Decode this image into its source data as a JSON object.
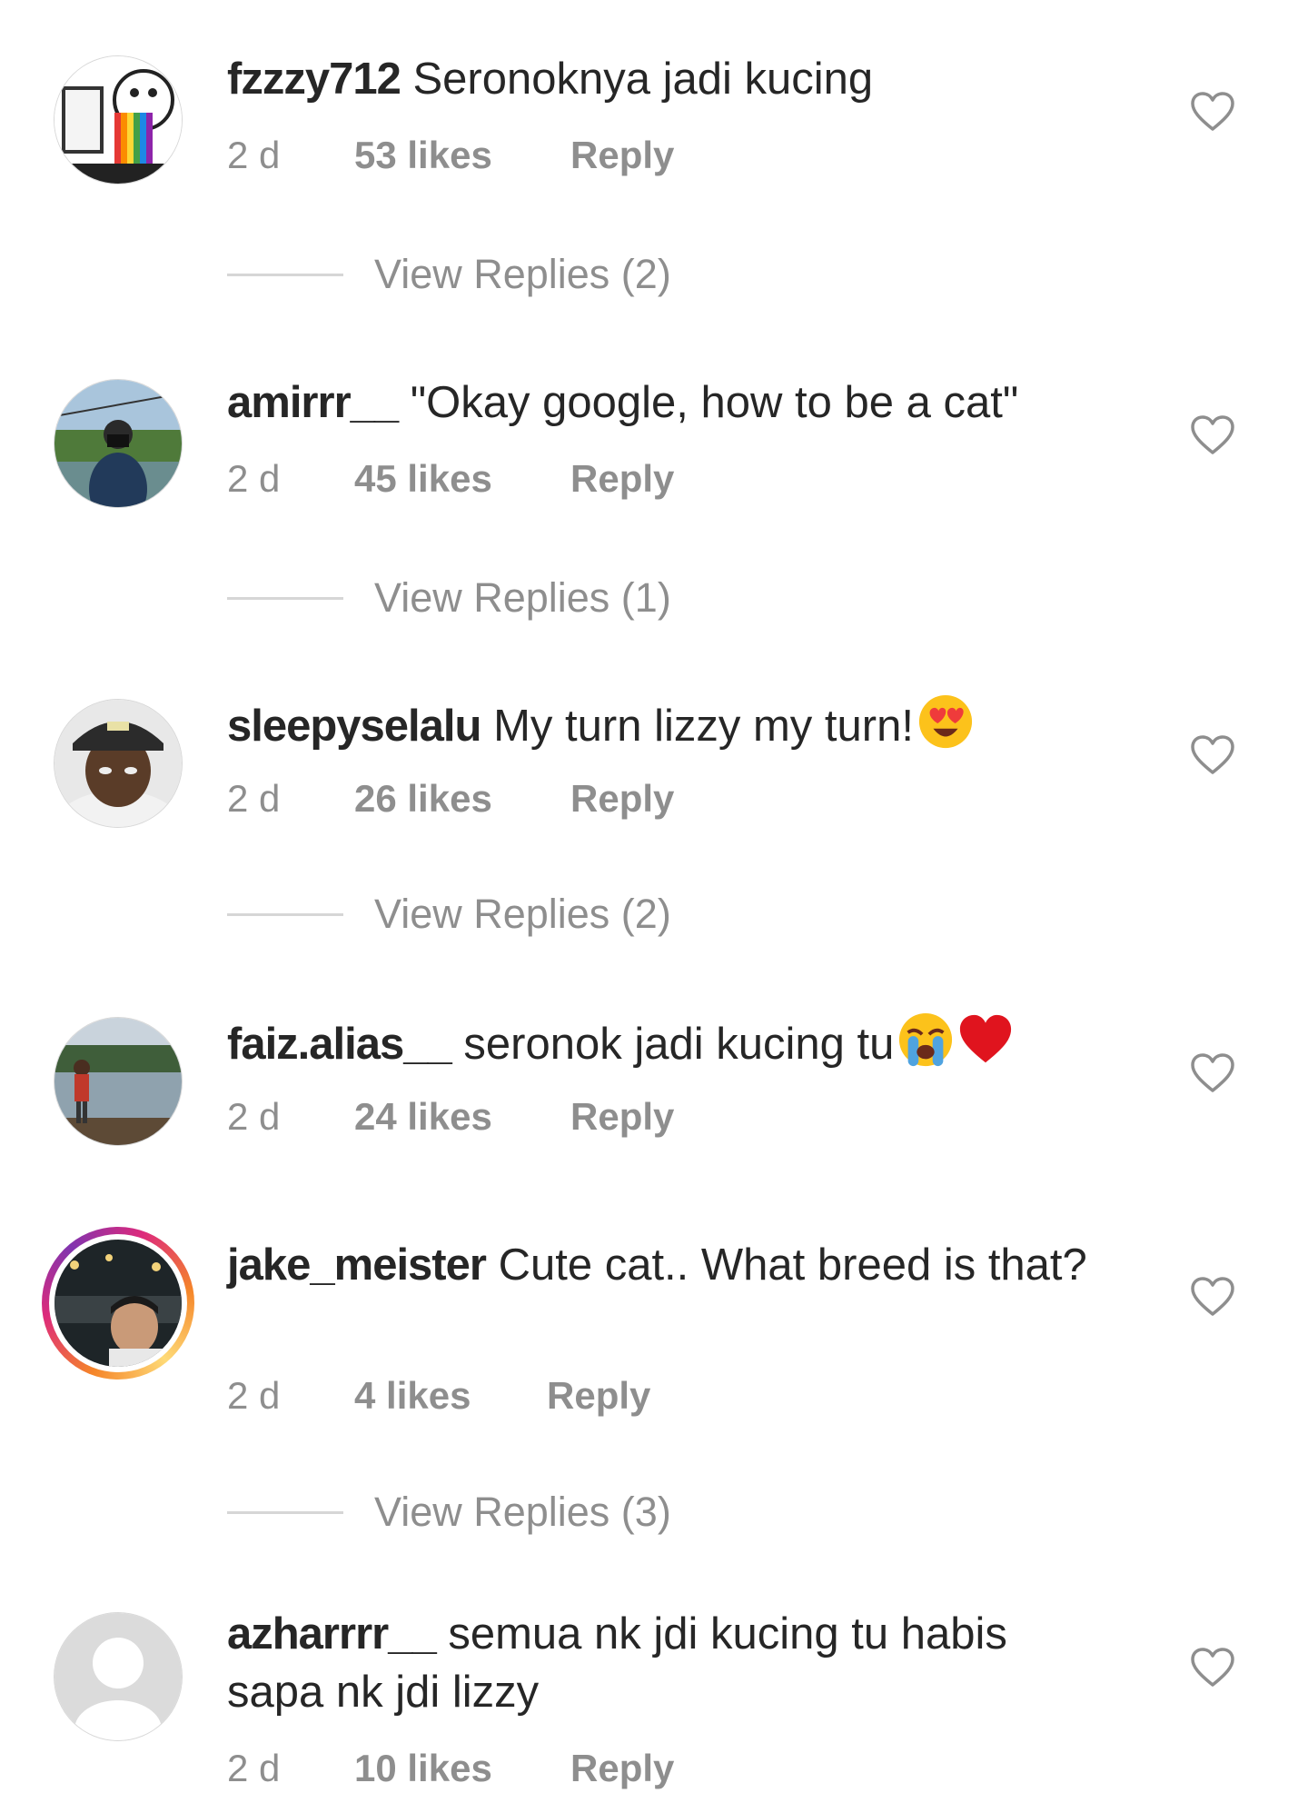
{
  "colors": {
    "text": "#262626",
    "muted": "#8e8e8e",
    "divider": "#d6d6d6",
    "heart_outline": "#8e8e8e",
    "story_ring": [
      "#f58529",
      "#dd2a7b",
      "#8134af",
      "#feda77"
    ]
  },
  "comments": [
    {
      "username": "fzzzy712",
      "text": "Seronoknya jadi kucing",
      "time": "2 d",
      "likes": "53 likes",
      "reply": "Reply",
      "view_replies": "View Replies (2)",
      "avatar_icon": "rainbow-meme-avatar",
      "emojis": []
    },
    {
      "username": "amirrr__",
      "text": "\"Okay google, how to be a cat\"",
      "time": "2 d",
      "likes": "45 likes",
      "reply": "Reply",
      "view_replies": "View Replies (1)",
      "avatar_icon": "photographer-avatar",
      "emojis": []
    },
    {
      "username": "sleepyselalu",
      "text": "My turn lizzy my turn!",
      "time": "2 d",
      "likes": "26 likes",
      "reply": "Reply",
      "view_replies": "View Replies (2)",
      "avatar_icon": "cap-portrait-avatar",
      "emojis": [
        "heart-eyes-emoji"
      ]
    },
    {
      "username": "faiz.alias__",
      "text": "seronok jadi kucing tu",
      "time": "2 d",
      "likes": "24 likes",
      "reply": "Reply",
      "view_replies": "",
      "avatar_icon": "lake-avatar",
      "emojis": [
        "crying-emoji",
        "red-heart-emoji"
      ]
    },
    {
      "username": "jake_meister",
      "text": "Cute cat.. What breed is that?",
      "time": "2 d",
      "likes": "4 likes",
      "reply": "Reply",
      "view_replies": "View Replies (3)",
      "avatar_icon": "night-portrait-avatar",
      "has_story": true,
      "emojis": []
    },
    {
      "username": "azharrrr__",
      "text": "semua nk jdi kucing tu habis sapa nk jdi lizzy",
      "time": "2 d",
      "likes": "10 likes",
      "reply": "Reply",
      "view_replies": "",
      "avatar_icon": "default-user-avatar",
      "emojis": []
    }
  ]
}
